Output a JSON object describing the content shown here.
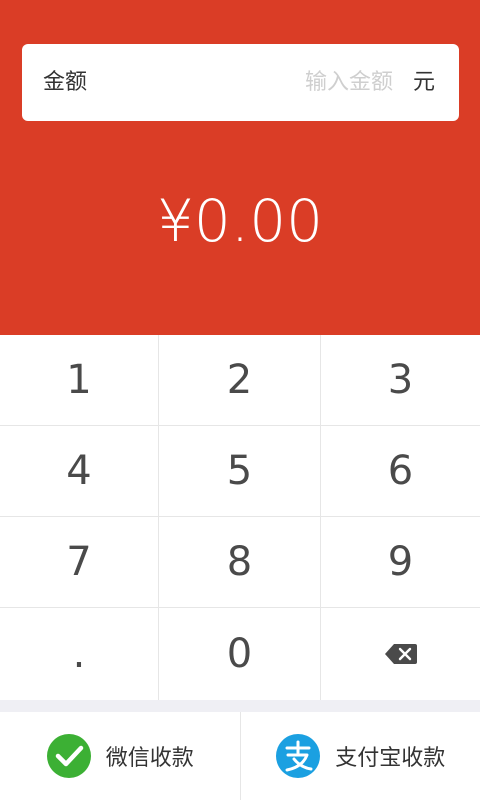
{
  "amount_field": {
    "label": "金额",
    "placeholder": "输入金额",
    "unit": "元"
  },
  "display_amount": "¥0.00",
  "keypad": {
    "keys": [
      "1",
      "2",
      "3",
      "4",
      "5",
      "6",
      "7",
      "8",
      "9",
      ".",
      "0"
    ],
    "backspace_icon": "backspace-icon"
  },
  "payment": {
    "wechat_label": "微信收款",
    "wechat_icon": "wechat-check-icon",
    "wechat_color": "#3cb034",
    "alipay_label": "支付宝收款",
    "alipay_icon": "alipay-icon",
    "alipay_color": "#1ba0e1"
  },
  "colors": {
    "header": "#da3d26"
  }
}
